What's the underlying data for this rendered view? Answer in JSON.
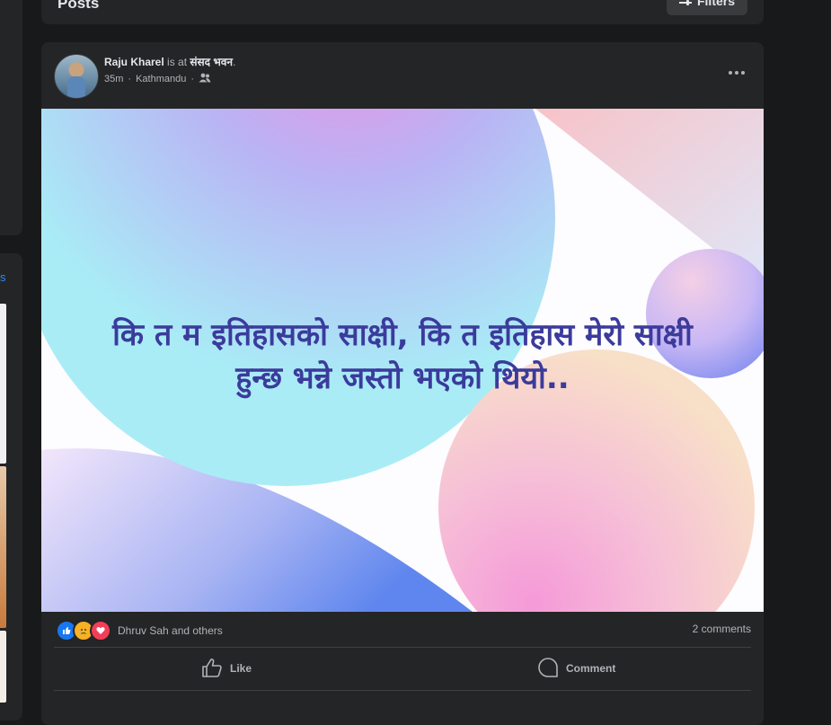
{
  "left_column": {
    "link_text": "s"
  },
  "posts_header": {
    "title": "Posts",
    "filters_label": "Filters"
  },
  "post": {
    "author": "Raju Kharel",
    "is_at": "is at",
    "place": "संसद भवन",
    "period": ".",
    "time": "35m",
    "separator": "·",
    "location": "Kathmandu",
    "audience_icon": "friends-icon",
    "text_line1": "कि त म इतिहासको साक्षी, कि त इतिहास मेरो साक्षी",
    "text_line2": "हुन्छ भन्ने जस्तो भएको थियो..",
    "reaction_icons": [
      "like-reaction",
      "sad-reaction",
      "love-reaction"
    ],
    "reactions_text": "Dhruv Sah and others",
    "comments_text": "2 comments",
    "like_label": "Like",
    "comment_label": "Comment"
  },
  "colors": {
    "background": "#18191a",
    "card": "#242526",
    "text_primary": "#e4e6eb",
    "text_secondary": "#b0b3b8",
    "post_text": "#3b3b9c",
    "like": "#1877f2",
    "love": "#f33e58",
    "sad": "#f7b125"
  }
}
